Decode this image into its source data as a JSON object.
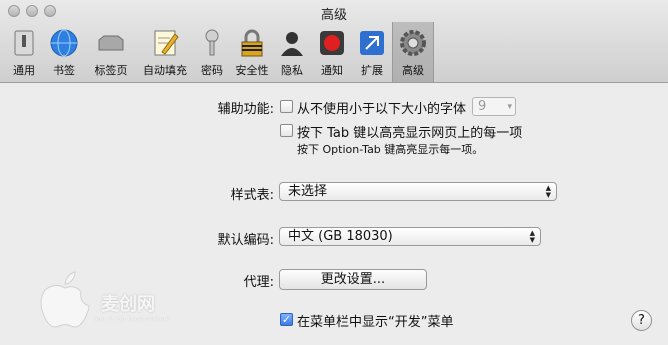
{
  "window": {
    "title": "高级"
  },
  "toolbar": {
    "tabs": [
      {
        "label": "通用",
        "icon": "switch-icon"
      },
      {
        "label": "书签",
        "icon": "globe-icon"
      },
      {
        "label": "标签页",
        "icon": "tabs-icon"
      },
      {
        "label": "自动填充",
        "icon": "pencil-form-icon"
      },
      {
        "label": "密码",
        "icon": "key-icon"
      },
      {
        "label": "安全性",
        "icon": "lock-icon"
      },
      {
        "label": "隐私",
        "icon": "person-silhouette-icon"
      },
      {
        "label": "通知",
        "icon": "record-icon"
      },
      {
        "label": "扩展",
        "icon": "puzzle-icon"
      },
      {
        "label": "高级",
        "icon": "gear-icon"
      }
    ],
    "active": "高级"
  },
  "accessibility": {
    "label": "辅助功能:",
    "never_font_size_label": "从不使用小于以下大小的字体",
    "font_size_value": "9",
    "tab_highlight_label": "按下 Tab 键以高亮显示网页上的每一项",
    "option_tab_note": "按下 Option-Tab 键高亮显示每一项。"
  },
  "stylesheet": {
    "label": "样式表:",
    "value": "未选择"
  },
  "encoding": {
    "label": "默认编码:",
    "value": "中文 (GB 18030)"
  },
  "proxy": {
    "label": "代理:",
    "button": "更改设置..."
  },
  "develop_menu": {
    "label": "在菜单栏中显示“开发”菜单",
    "checked": true
  },
  "help": {
    "label": "?"
  },
  "watermark": {
    "text": "麦创网",
    "sub": "Your Pc For Macs network"
  }
}
